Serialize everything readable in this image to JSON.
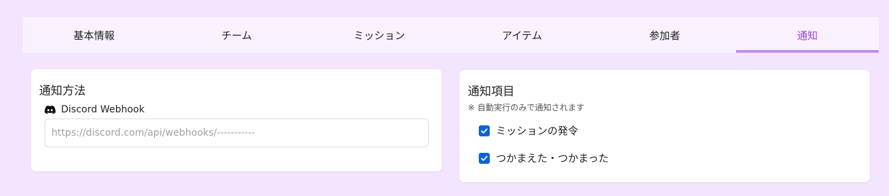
{
  "tabs": [
    {
      "label": "基本情報"
    },
    {
      "label": "チーム"
    },
    {
      "label": "ミッション"
    },
    {
      "label": "アイテム"
    },
    {
      "label": "参加者"
    },
    {
      "label": "通知"
    }
  ],
  "active_tab": "通知",
  "notification_method": {
    "title": "通知方法",
    "webhook_label": "Discord Webhook",
    "webhook_icon": "discord-icon",
    "webhook_url_value": "",
    "webhook_url_placeholder": "https://discord.com/api/webhooks/-----------"
  },
  "notification_items": {
    "title": "通知項目",
    "note": "※ 自動実行のみで通知されます",
    "options": [
      {
        "label": "ミッションの発令",
        "checked": true
      },
      {
        "label": "つかまえた・つかまった",
        "checked": true
      }
    ]
  },
  "colors": {
    "background": "#f3e5fd",
    "tab_bar": "#f9f2fe",
    "accent": "#9b44d9",
    "accent_underline": "#c38ee9",
    "checkbox": "#0b63d6"
  }
}
